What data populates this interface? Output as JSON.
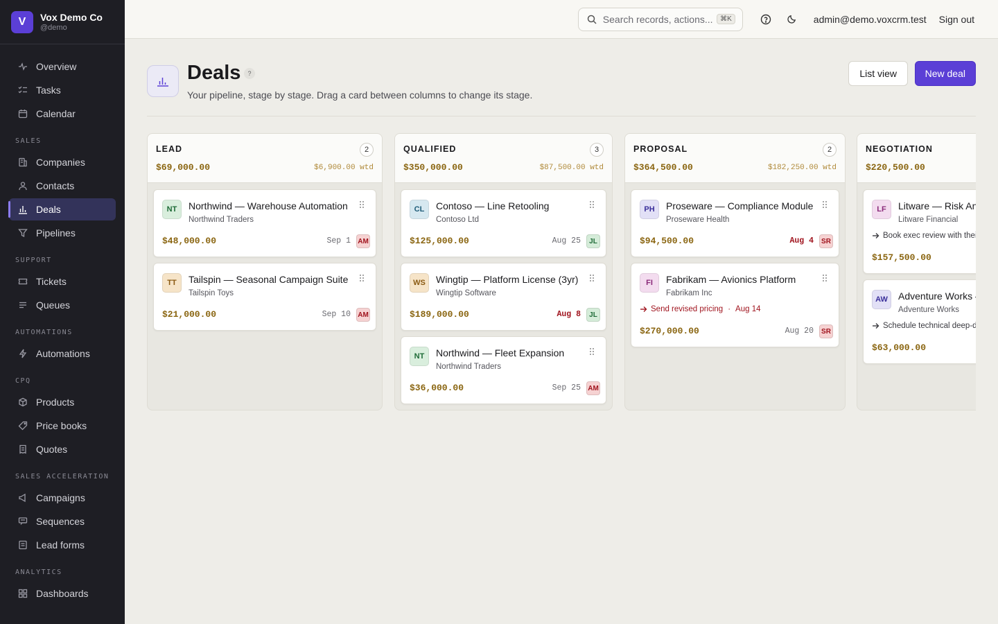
{
  "workspace": {
    "logo_letter": "V",
    "name": "Vox Demo Co",
    "handle": "@demo"
  },
  "nav": {
    "main": [
      {
        "label": "Overview",
        "icon": "activity-icon"
      },
      {
        "label": "Tasks",
        "icon": "checklist-icon"
      },
      {
        "label": "Calendar",
        "icon": "calendar-icon"
      }
    ],
    "sections": [
      {
        "title": "SALES",
        "items": [
          "Companies",
          "Contacts",
          "Deals",
          "Pipelines"
        ]
      },
      {
        "title": "SUPPORT",
        "items": [
          "Tickets",
          "Queues"
        ]
      },
      {
        "title": "AUTOMATIONS",
        "items": [
          "Automations"
        ]
      },
      {
        "title": "CPQ",
        "items": [
          "Products",
          "Price books",
          "Quotes"
        ]
      },
      {
        "title": "SALES ACCELERATION",
        "items": [
          "Campaigns",
          "Sequences",
          "Lead forms"
        ]
      },
      {
        "title": "ANALYTICS",
        "items": [
          "Dashboards"
        ]
      }
    ],
    "active": "Deals"
  },
  "topbar": {
    "search_placeholder": "Search records, actions...",
    "search_shortcut": "⌘K",
    "user_email": "admin@demo.voxcrm.test",
    "signout_label": "Sign out"
  },
  "page": {
    "title": "Deals",
    "help_glyph": "?",
    "subtitle": "Your pipeline, stage by stage. Drag a card between columns to change its stage.",
    "list_view_label": "List view",
    "new_deal_label": "New deal"
  },
  "columns": [
    {
      "name": "LEAD",
      "count": "2",
      "total": "$69,000.00",
      "wtd": "$6,900.00 wtd",
      "cards": [
        {
          "initials": "NT",
          "title": "Northwind — Warehouse Automation",
          "company": "Northwind Traders",
          "amount": "$48,000.00",
          "date": "Sep 1",
          "overdue": false,
          "owner": "AM",
          "next": ""
        },
        {
          "initials": "TT",
          "title": "Tailspin — Seasonal Campaign Suite",
          "company": "Tailspin Toys",
          "amount": "$21,000.00",
          "date": "Sep 10",
          "overdue": false,
          "owner": "AM",
          "next": ""
        }
      ]
    },
    {
      "name": "QUALIFIED",
      "count": "3",
      "total": "$350,000.00",
      "wtd": "$87,500.00 wtd",
      "cards": [
        {
          "initials": "CL",
          "title": "Contoso — Line Retooling",
          "company": "Contoso Ltd",
          "amount": "$125,000.00",
          "date": "Aug 25",
          "overdue": false,
          "owner": "JL",
          "next": ""
        },
        {
          "initials": "WS",
          "title": "Wingtip — Platform License (3yr)",
          "company": "Wingtip Software",
          "amount": "$189,000.00",
          "date": "Aug 8",
          "overdue": true,
          "owner": "JL",
          "next": ""
        },
        {
          "initials": "NT",
          "title": "Northwind — Fleet Expansion",
          "company": "Northwind Traders",
          "amount": "$36,000.00",
          "date": "Sep 25",
          "overdue": false,
          "owner": "AM",
          "next": ""
        }
      ]
    },
    {
      "name": "PROPOSAL",
      "count": "2",
      "total": "$364,500.00",
      "wtd": "$182,250.00 wtd",
      "cards": [
        {
          "initials": "PH",
          "title": "Proseware — Compliance Module",
          "company": "Proseware Health",
          "amount": "$94,500.00",
          "date": "Aug 4",
          "overdue": true,
          "owner": "SR",
          "next": ""
        },
        {
          "initials": "FI",
          "title": "Fabrikam — Avionics Platform",
          "company": "Fabrikam Inc",
          "amount": "$270,000.00",
          "date": "Aug 20",
          "overdue": false,
          "owner": "SR",
          "next": "Send revised pricing",
          "next_date": "Aug 14",
          "next_overdue": true
        }
      ]
    },
    {
      "name": "NEGOTIATION",
      "count": "",
      "total": "$220,500.00",
      "wtd": "",
      "cards": [
        {
          "initials": "LF",
          "title": "Litware — Risk Analytics",
          "company": "Litware Financial",
          "amount": "$157,500.00",
          "date": "",
          "overdue": false,
          "owner": "",
          "next": "Book exec review with their CFO",
          "next_date": "",
          "next_overdue": false
        },
        {
          "initials": "AW",
          "title": "Adventure Works — Expansion",
          "company": "Adventure Works",
          "amount": "$63,000.00",
          "date": "",
          "overdue": false,
          "owner": "",
          "next": "Schedule technical deep-dive",
          "next_date": "",
          "next_overdue": false
        }
      ]
    }
  ],
  "colors": {
    "accent": "#5b3fd6",
    "sidebar_bg": "#1e1e24",
    "amount": "#8a6510",
    "overdue": "#a0141e",
    "avatar_NT": "#d9eedd",
    "avatar_TT": "#f6e4c8",
    "avatar_CL": "#d6e8f0",
    "avatar_WS": "#f6e4c8",
    "avatar_PH": "#e2e0f6",
    "avatar_FI": "#f3dcef",
    "avatar_LF": "#f3dcef",
    "avatar_AW": "#e2e0f6",
    "owner_AM": "#f6d2d2",
    "owner_JL": "#d5ecd9",
    "owner_SR": "#f6d2d2"
  }
}
